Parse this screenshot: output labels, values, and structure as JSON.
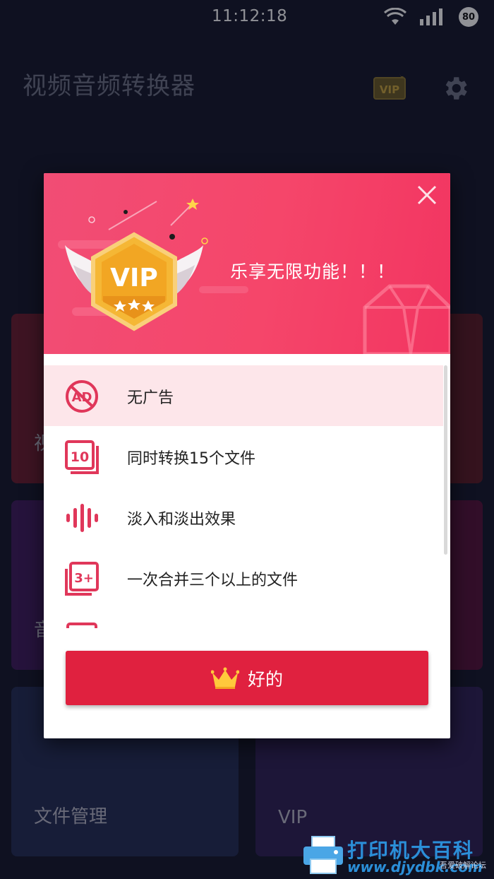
{
  "status_bar": {
    "time": "11:12:18",
    "battery": "80"
  },
  "app_bar": {
    "title": "视频音频转换器"
  },
  "tiles": {
    "video_label": "视",
    "audio_label": "音",
    "file_manager_label": "文件管理",
    "vip_label": "VIP"
  },
  "dialog": {
    "badge_text": "VIP",
    "headline": "乐享无限功能！！！",
    "features": [
      {
        "label": "无广告",
        "icon": "no-ads-icon"
      },
      {
        "label": "同时转换15个文件",
        "icon": "ten-files-icon"
      },
      {
        "label": "淡入和淡出效果",
        "icon": "waveform-icon"
      },
      {
        "label": "一次合并三个以上的文件",
        "icon": "merge-three-plus-icon"
      }
    ],
    "ok_label": "好的"
  },
  "watermark": {
    "text": "打印机大百科",
    "url": "www.djydbk.com",
    "small": "吾爱破解论坛"
  },
  "colors": {
    "accent": "#e0213f",
    "header_pink": "#f14d75",
    "background": "#14172a"
  }
}
